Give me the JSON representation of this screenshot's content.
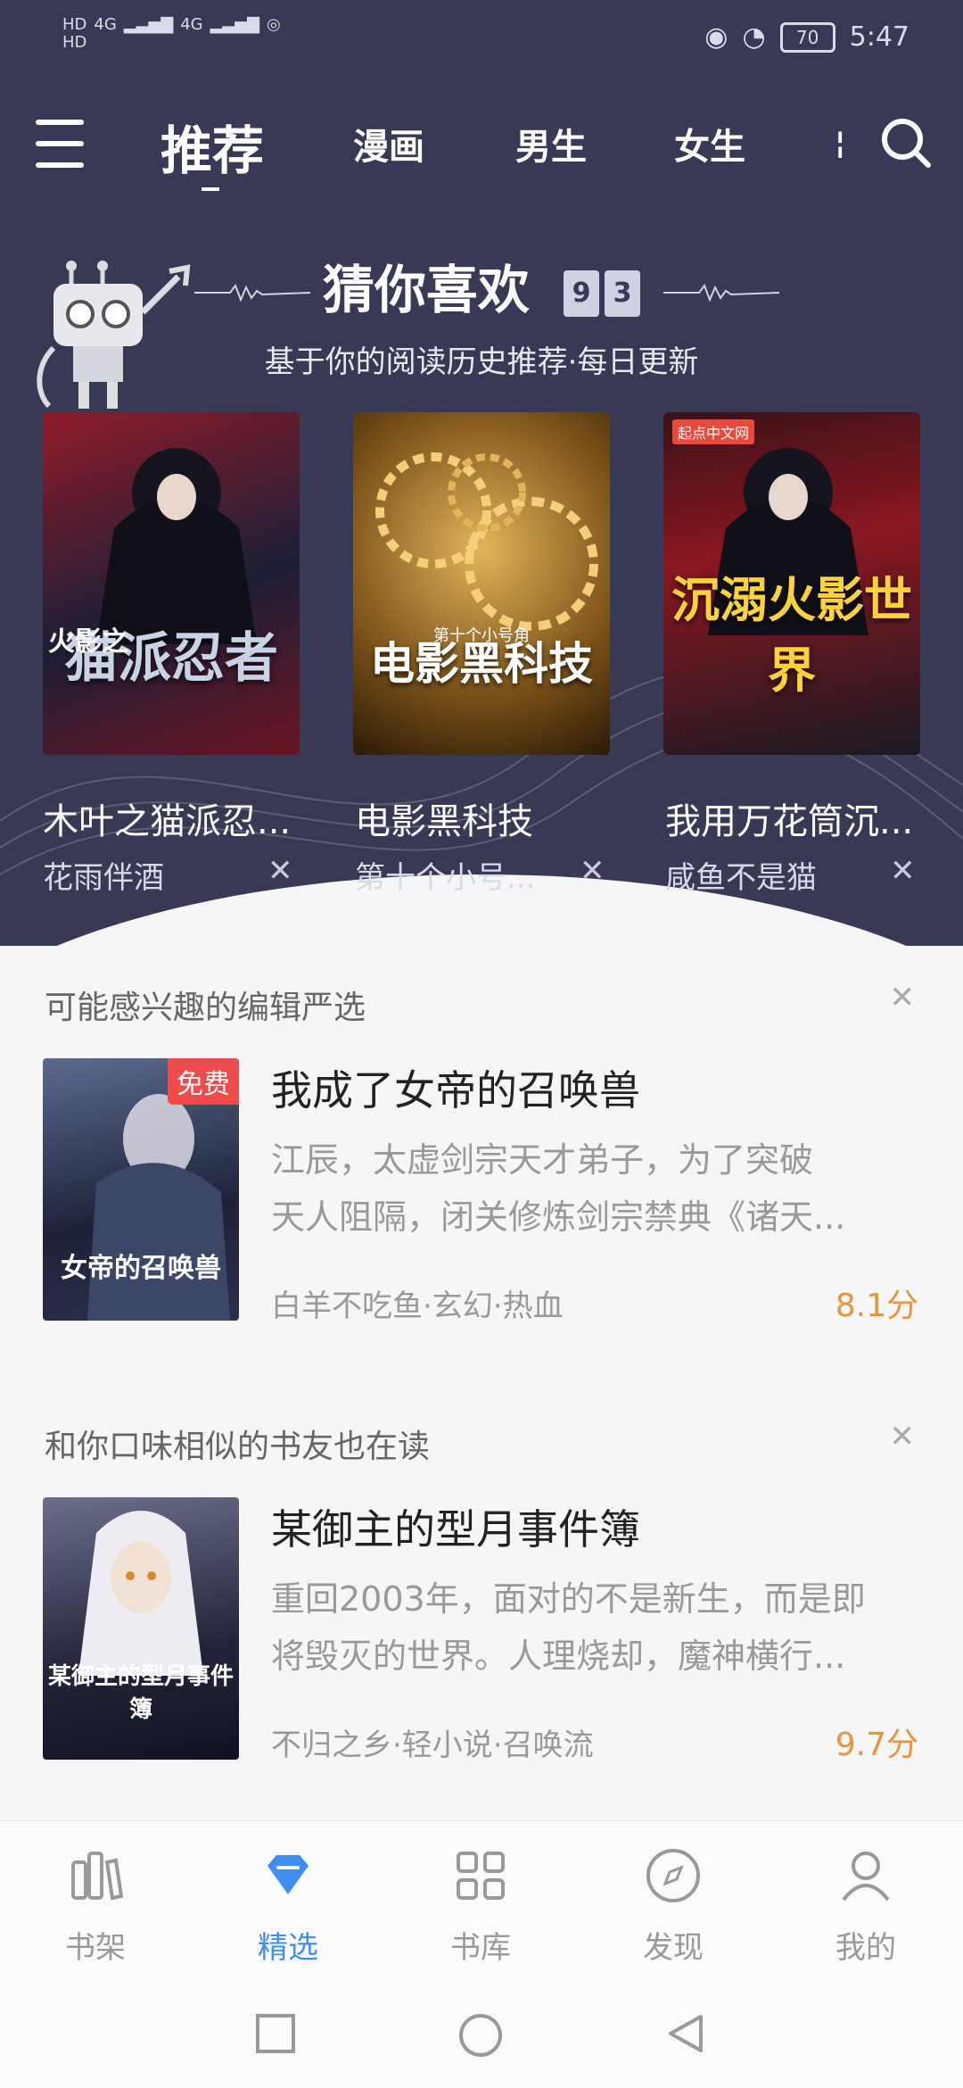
{
  "status": {
    "signal_left": [
      "HD",
      "HD"
    ],
    "net": [
      "4G",
      "4G"
    ],
    "battery": "70",
    "time": "5:47"
  },
  "nav": {
    "tabs": [
      "推荐",
      "漫画",
      "男生",
      "女生"
    ],
    "active": "推荐"
  },
  "guess": {
    "title": "猜你喜欢",
    "date_digits": [
      "9",
      "3"
    ],
    "subtitle": "基于你的阅读历史推荐·每日更新",
    "books": [
      {
        "name": "木叶之猫派忍...",
        "author": "花雨伴酒",
        "cover_title": "猫派忍者",
        "cover_small": "火影之"
      },
      {
        "name": "电影黑科技",
        "author": "第十个小号...",
        "cover_title": "电影黑科技",
        "cover_small": "第十个小号角"
      },
      {
        "name": "我用万花筒沉...",
        "author": "咸鱼不是猫",
        "cover_title": "沉溺火影世界",
        "cover_small": "起点中文网"
      }
    ]
  },
  "sections": [
    {
      "title": "可能感兴趣的编辑严选",
      "book": {
        "name": "我成了女帝的召唤兽",
        "desc1": "江辰，太虚剑宗天才弟子，为了突破",
        "desc2": "天人阻隔，闭关修炼剑宗禁典《诸天...",
        "meta": "白羊不吃鱼·玄幻·热血",
        "score": "8.1分",
        "badge": "免费",
        "cover_title": "女帝的召唤兽"
      }
    },
    {
      "title": "和你口味相似的书友也在读",
      "book": {
        "name": "某御主的型月事件簿",
        "desc1": "重回2003年，面对的不是新生，而是即",
        "desc2": "将毁灭的世界。人理烧却，魔神横行...",
        "meta": "不归之乡·轻小说·召唤流",
        "score": "9.7分",
        "cover_title": "某御主的型月事件簿"
      }
    }
  ],
  "tabbar": [
    "书架",
    "精选",
    "书库",
    "发现",
    "我的"
  ],
  "tabbar_active": "精选",
  "colors": {
    "header_bg": "#383a55",
    "accent": "#3f8ff0",
    "score": "#e8953a",
    "free": "#ef4b4b"
  }
}
